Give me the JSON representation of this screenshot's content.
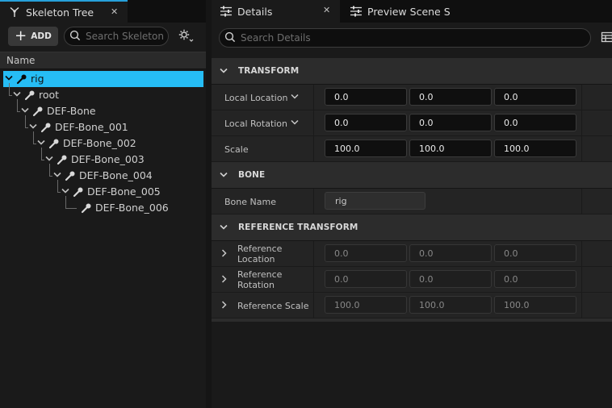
{
  "left_panel": {
    "tab_label": "Skeleton Tree",
    "add_label": "ADD",
    "search_placeholder": "Search Skeleton",
    "column_header": "Name",
    "tree": [
      {
        "label": "rig",
        "depth": 0,
        "selected": true
      },
      {
        "label": "root",
        "depth": 1,
        "selected": false
      },
      {
        "label": "DEF-Bone",
        "depth": 2,
        "selected": false
      },
      {
        "label": "DEF-Bone_001",
        "depth": 3,
        "selected": false
      },
      {
        "label": "DEF-Bone_002",
        "depth": 4,
        "selected": false
      },
      {
        "label": "DEF-Bone_003",
        "depth": 5,
        "selected": false
      },
      {
        "label": "DEF-Bone_004",
        "depth": 6,
        "selected": false
      },
      {
        "label": "DEF-Bone_005",
        "depth": 7,
        "selected": false
      },
      {
        "label": "DEF-Bone_006",
        "depth": 8,
        "selected": false
      }
    ]
  },
  "right_panel": {
    "tabs": {
      "details": "Details",
      "preview": "Preview Scene Settings"
    },
    "search_placeholder": "Search Details",
    "categories": {
      "transform": {
        "title": "TRANSFORM",
        "local_location": {
          "label": "Local Location",
          "x": "0.0",
          "y": "0.0",
          "z": "0.0"
        },
        "local_rotation": {
          "label": "Local Rotation",
          "x": "0.0",
          "y": "0.0",
          "z": "0.0"
        },
        "scale": {
          "label": "Scale",
          "x": "100.0",
          "y": "100.0",
          "z": "100.0"
        }
      },
      "bone": {
        "title": "BONE",
        "bone_name": {
          "label": "Bone Name",
          "value": "rig"
        }
      },
      "reference_transform": {
        "title": "REFERENCE TRANSFORM",
        "reference_location": {
          "label": "Reference Location",
          "x": "0.0",
          "y": "0.0",
          "z": "0.0"
        },
        "reference_rotation": {
          "label": "Reference Rotation",
          "x": "0.0",
          "y": "0.0",
          "z": "0.0"
        },
        "reference_scale": {
          "label": "Reference Scale",
          "x": "100.0",
          "y": "100.0",
          "z": "100.0"
        }
      }
    }
  },
  "colors": {
    "selection": "#26bdf5",
    "active_tab_accent": "#26a0da",
    "panel_bg": "#1a1a1a"
  }
}
